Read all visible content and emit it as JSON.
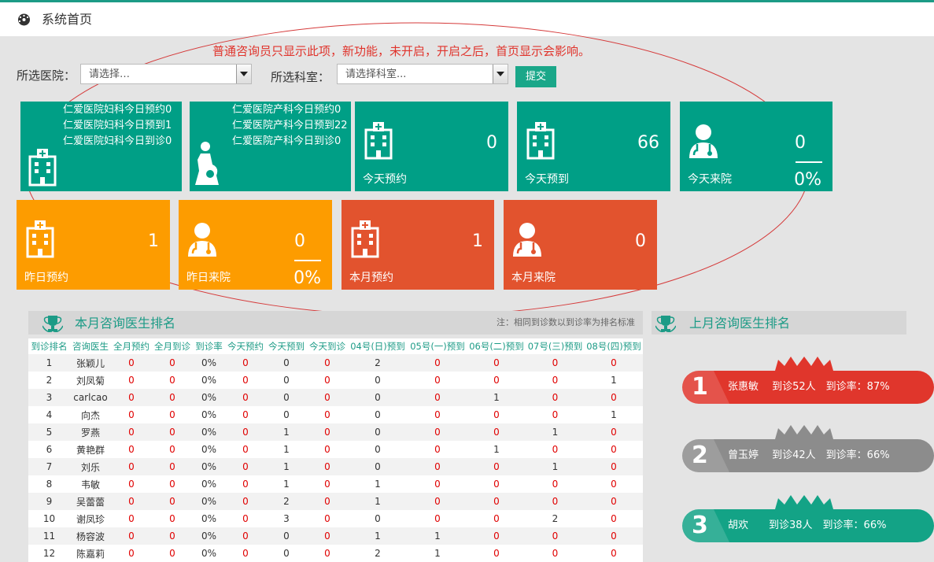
{
  "header": {
    "title": "系统首页"
  },
  "notice": "普通咨询员只显示此项，新功能，未开启，开启之后，首页显示会影响。",
  "filters": {
    "hospital_label": "所选医院：",
    "hospital_value": "请选择…",
    "dept_label": "所选科室：",
    "dept_value": "请选择科室...",
    "submit": "提交"
  },
  "tiles": {
    "gyn": {
      "lines": [
        "仁爱医院妇科今日预约0",
        "仁爱医院妇科今日预到1",
        "仁爱医院妇科今日到诊0"
      ]
    },
    "obs": {
      "lines": [
        "仁爱医院产科今日预约0",
        "仁爱医院产科今日预到22",
        "仁爱医院产科今日到诊0"
      ]
    },
    "today_booked": {
      "value": "0",
      "label": "今天预约"
    },
    "today_expected": {
      "value": "66",
      "label": "今天预到"
    },
    "today_arrived": {
      "value": "0",
      "pct": "0%",
      "label": "今天来院"
    },
    "yest_booked": {
      "value": "1",
      "label": "昨日预约"
    },
    "yest_arrived": {
      "value": "0",
      "pct": "0%",
      "label": "昨日来院"
    },
    "month_booked": {
      "value": "1",
      "label": "本月预约"
    },
    "month_arrived": {
      "value": "0",
      "label": "本月来院"
    }
  },
  "month_rank": {
    "title": "本月咨询医生排名",
    "note": "注：相同到诊数以到诊率为排名标准",
    "columns": [
      "到诊排名",
      "咨询医生",
      "全月预约",
      "全月到诊",
      "到诊率",
      "今天预约",
      "今天预到",
      "今天到诊",
      "04号(日)预到",
      "05号(一)预到",
      "06号(二)预到",
      "07号(三)预到",
      "08号(四)预到"
    ],
    "rows": [
      [
        "1",
        "张颖儿",
        "0",
        "0",
        "0%",
        "0",
        "0",
        "0",
        "2",
        "0",
        "0",
        "0",
        "0"
      ],
      [
        "2",
        "刘凤菊",
        "0",
        "0",
        "0%",
        "0",
        "0",
        "0",
        "0",
        "0",
        "0",
        "0",
        "1"
      ],
      [
        "3",
        "carlcao",
        "0",
        "0",
        "0%",
        "0",
        "0",
        "0",
        "0",
        "0",
        "1",
        "0",
        "0"
      ],
      [
        "4",
        "向杰",
        "0",
        "0",
        "0%",
        "0",
        "0",
        "0",
        "0",
        "0",
        "0",
        "0",
        "1"
      ],
      [
        "5",
        "罗燕",
        "0",
        "0",
        "0%",
        "0",
        "1",
        "0",
        "0",
        "0",
        "0",
        "1",
        "0"
      ],
      [
        "6",
        "黄艳群",
        "0",
        "0",
        "0%",
        "0",
        "1",
        "0",
        "0",
        "0",
        "1",
        "0",
        "0"
      ],
      [
        "7",
        "刘乐",
        "0",
        "0",
        "0%",
        "0",
        "1",
        "0",
        "0",
        "0",
        "0",
        "1",
        "0"
      ],
      [
        "8",
        "韦敏",
        "0",
        "0",
        "0%",
        "0",
        "1",
        "0",
        "1",
        "0",
        "0",
        "0",
        "0"
      ],
      [
        "9",
        "吴蕾蕾",
        "0",
        "0",
        "0%",
        "0",
        "2",
        "0",
        "1",
        "0",
        "0",
        "0",
        "0"
      ],
      [
        "10",
        "谢凤珍",
        "0",
        "0",
        "0%",
        "0",
        "3",
        "0",
        "0",
        "0",
        "0",
        "2",
        "0"
      ],
      [
        "11",
        "杨容波",
        "0",
        "0",
        "0%",
        "0",
        "0",
        "0",
        "1",
        "1",
        "0",
        "0",
        "0"
      ],
      [
        "12",
        "陈嘉莉",
        "0",
        "0",
        "0%",
        "0",
        "0",
        "0",
        "2",
        "1",
        "0",
        "0",
        "0"
      ]
    ]
  },
  "last_rank": {
    "title": "上月咨询医生排名",
    "items": [
      {
        "num": "1",
        "text": "张惠敏　 到诊52人　到诊率：87%",
        "color": "#e0362c"
      },
      {
        "num": "2",
        "text": "曾玉婷　 到诊42人　到诊率：66%",
        "color": "#8c8c8c"
      },
      {
        "num": "3",
        "text": "胡欢　　到诊38人　到诊率：66%",
        "color": "#13a386"
      }
    ]
  },
  "colors": {
    "green": "#009f86",
    "orange": "#fd9c00",
    "red": "#e2532e",
    "accent": "#1c9b86"
  }
}
